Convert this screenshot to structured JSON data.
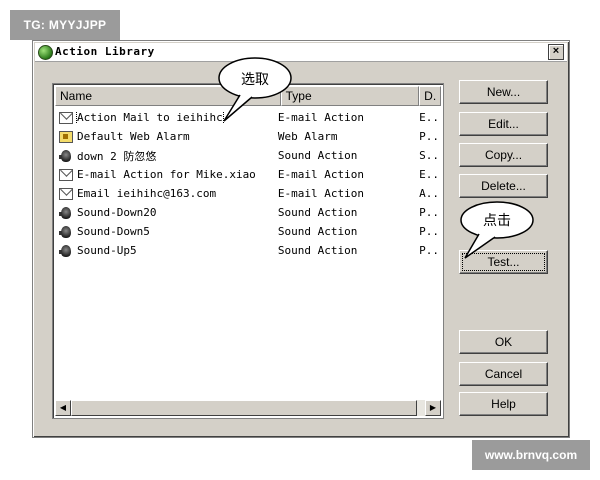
{
  "watermarks": {
    "top_left": "TG: MYYJJPP",
    "bottom_right": "www.brnvq.com"
  },
  "dialog": {
    "title": "Action Library",
    "close_glyph": "×"
  },
  "list": {
    "columns": [
      "Name",
      "Type",
      "D."
    ],
    "rows": [
      {
        "icon": "mail-icon",
        "name": "Action Mail to ieihihc",
        "type": "E-mail Action",
        "d": "E..",
        "selected": true
      },
      {
        "icon": "web-icon",
        "name": "Default Web Alarm",
        "type": "Web Alarm",
        "d": "P.."
      },
      {
        "icon": "sound-icon",
        "name": "down 2 防忽悠",
        "type": "Sound Action",
        "d": "S.."
      },
      {
        "icon": "mail-icon",
        "name": "E-mail Action for Mike.xiao",
        "type": "E-mail Action",
        "d": "E.."
      },
      {
        "icon": "mail-icon",
        "name": "Email ieihihc@163.com",
        "type": "E-mail Action",
        "d": "A.."
      },
      {
        "icon": "sound-icon",
        "name": "Sound-Down20",
        "type": "Sound Action",
        "d": "P.."
      },
      {
        "icon": "sound-icon",
        "name": "Sound-Down5",
        "type": "Sound Action",
        "d": "P.."
      },
      {
        "icon": "sound-icon",
        "name": "Sound-Up5",
        "type": "Sound Action",
        "d": "P.."
      }
    ]
  },
  "buttons": {
    "new": "New...",
    "edit": "Edit...",
    "copy": "Copy...",
    "delete": "Delete...",
    "test": "Test...",
    "ok": "OK",
    "cancel": "Cancel",
    "help": "Help"
  },
  "annotations": {
    "select_bubble": "选取",
    "click_bubble": "点击"
  },
  "scroll": {
    "left_glyph": "◀",
    "right_glyph": "▶"
  }
}
